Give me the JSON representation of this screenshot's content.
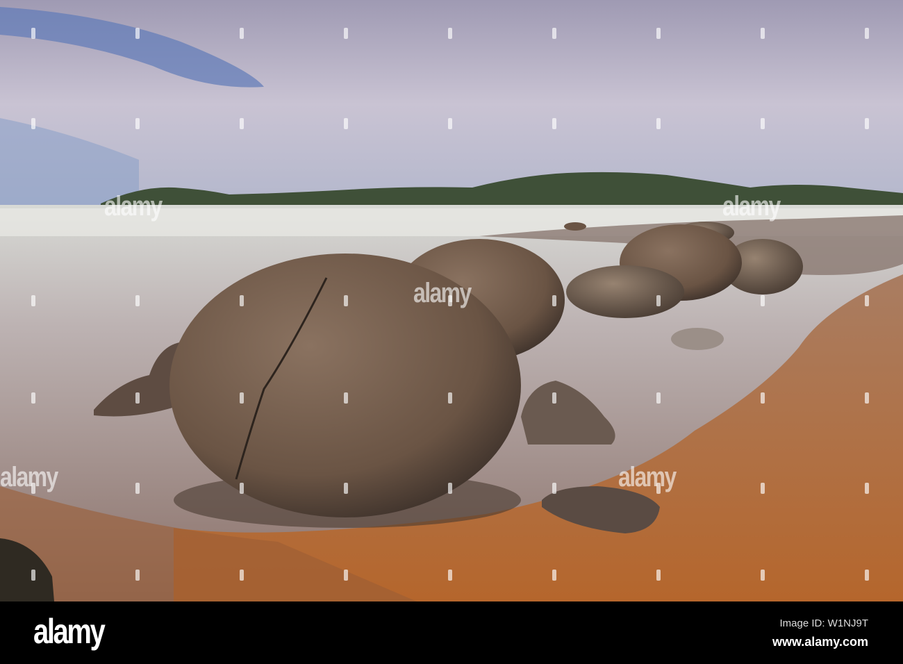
{
  "photo": {
    "subject": "Moeraki Boulders",
    "sky_color": "#b9b3c8",
    "sea_color": "#c9c3c6",
    "sand_color": "#b86a35",
    "boulder_color": "#6e5545"
  },
  "watermark": {
    "text": "alamy"
  },
  "footer": {
    "logo": "alamy",
    "image_id": "Image ID: W1NJ9T",
    "website": "www.alamy.com"
  }
}
